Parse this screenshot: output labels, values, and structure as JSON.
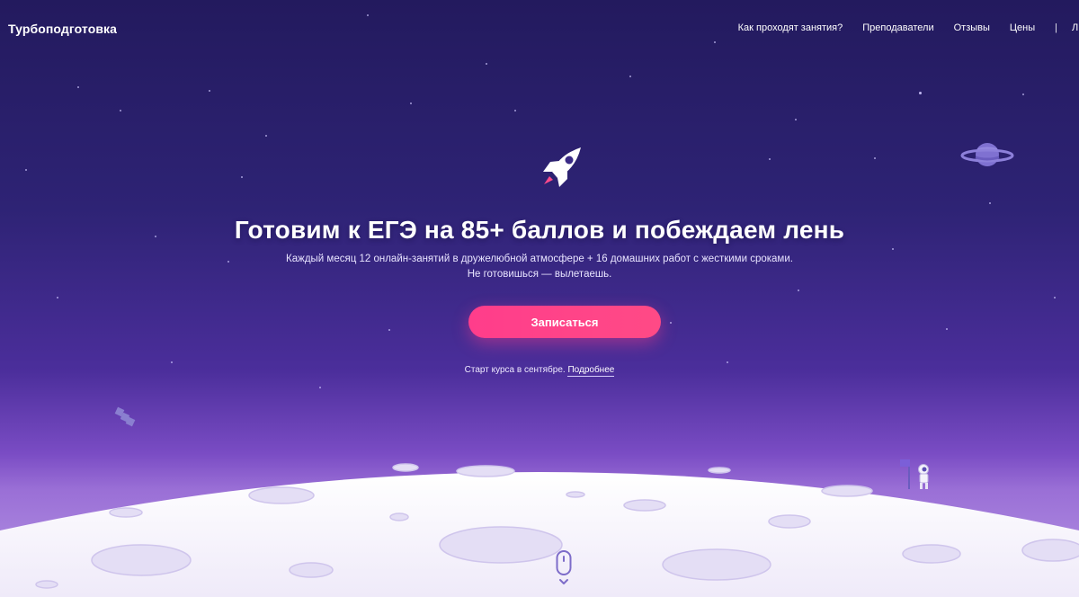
{
  "header": {
    "logo": "Турбоподготовка",
    "nav": [
      {
        "label": "Как проходят занятия?"
      },
      {
        "label": "Преподаватели"
      },
      {
        "label": "Отзывы"
      },
      {
        "label": "Цены"
      }
    ],
    "separator": "|",
    "cut_item": "Л"
  },
  "hero": {
    "title": "Готовим к ЕГЭ на 85+ баллов и побеждаем лень",
    "subtitle_line1": "Каждый месяц 12 онлайн-занятий в дружелюбной атмосфере + 16 домашних работ с жесткими сроками.",
    "subtitle_line2": "Не готовишься — вылетаешь.",
    "cta": "Записаться",
    "start_text": "Старт курса в сентябре.",
    "more_link": "Подробнее"
  },
  "icons": [
    "rocket-icon",
    "planet-icon",
    "satellite-icon",
    "astronaut-icon",
    "moon-surface",
    "scroll-mouse-icon",
    "chevron-down-icon"
  ],
  "colors": {
    "bg_top": "#231a5e",
    "bg_mid": "#4b2e9b",
    "cta": "#ff3d8b",
    "moon": "#f3f1fb",
    "crater": "#c7bde8"
  }
}
